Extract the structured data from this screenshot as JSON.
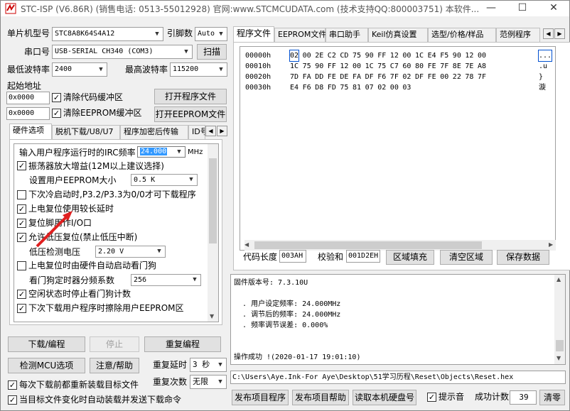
{
  "window": {
    "title": "STC-ISP (V6.86R) (销售电话: 0513-55012928) 官网:www.STCMCUDATA.com  (技术支持QQ:800003751) 本软件...",
    "minimize": "—",
    "maximize": "☐",
    "close": "✕"
  },
  "left": {
    "mcu_label": "单片机型号",
    "mcu_value": "STC8A8K64S4A12",
    "pins_label": "引脚数",
    "pins_value": "Auto",
    "port_label": "串口号",
    "port_value": "USB-SERIAL CH340 (COM3)",
    "scan_button": "扫描",
    "min_baud_label": "最低波特率",
    "min_baud_value": "2400",
    "max_baud_label": "最高波特率",
    "max_baud_value": "115200",
    "start_addr_label": "起始地址",
    "addr1_value": "0x0000",
    "clear_code_label": "清除代码缓冲区",
    "open_program_button": "打开程序文件",
    "addr2_value": "0x0000",
    "clear_eeprom_label": "清除EEPROM缓冲区",
    "open_eeprom_button": "打开EEPROM文件",
    "tabs": [
      "硬件选项",
      "脱机下载/U8/U7",
      "程序加密后传输",
      "ID号"
    ],
    "hw_options": {
      "irc_label": "输入用户程序运行时的IRC频率",
      "irc_value": "24.000",
      "irc_unit": "MHz",
      "opt1": "振荡器放大增益(12M以上建议选择)",
      "eeprom_size_label": "设置用户EEPROM大小",
      "eeprom_size_value": "0.5 K",
      "opt2": "下次冷启动时,P3.2/P3.3为0/0才可下载程序",
      "opt3": "上电复位使用较长延时",
      "opt4": "复位脚用作I/O口",
      "opt5": "允许低压复位(禁止低压中断)",
      "low_volt_label": "低压检测电压",
      "low_volt_value": "2.20 V",
      "opt6": "上电复位时由硬件自动启动看门狗",
      "wdt_label": "看门狗定时器分频系数",
      "wdt_value": "256",
      "opt7": "空闲状态时停止看门狗计数",
      "opt8": "下次下载用户程序时擦除用户EEPROM区"
    },
    "download_button": "下载/编程",
    "stop_button": "停止",
    "reprogram_button": "重复编程",
    "detect_button": "检测MCU选项",
    "notice_button": "注意/帮助",
    "repeat_delay_label": "重复延时",
    "repeat_delay_value": "3 秒",
    "repeat_count_label": "重复次数",
    "repeat_count_value": "无限",
    "reload_before_label": "每次下载前都重新装载目标文件",
    "auto_send_label": "当目标文件变化时自动装载并发送下载命令"
  },
  "right": {
    "tabs": [
      "程序文件",
      "EEPROM文件",
      "串口助手",
      "Keil仿真设置",
      "选型/价格/样品",
      "范例程序"
    ],
    "hex_rows": [
      {
        "addr": "00000h",
        "bytes": [
          "02",
          "00",
          "2E",
          "C2",
          "CD",
          "75",
          "90",
          "FF",
          "12",
          "00",
          "1C",
          "E4",
          "F5",
          "90",
          "12",
          "00"
        ],
        "ascii": "..."
      },
      {
        "addr": "00010h",
        "bytes": [
          "1C",
          "75",
          "90",
          "FF",
          "12",
          "00",
          "1C",
          "75",
          "C7",
          "60",
          "80",
          "FE",
          "7F",
          "8E",
          "7E",
          "A8"
        ],
        "ascii": ".u"
      },
      {
        "addr": "00020h",
        "bytes": [
          "7D",
          "FA",
          "DD",
          "FE",
          "DE",
          "FA",
          "DF",
          "F6",
          "7F",
          "02",
          "DF",
          "FE",
          "00",
          "22",
          "78",
          "7F"
        ],
        "ascii": "}"
      },
      {
        "addr": "00030h",
        "bytes": [
          "E4",
          "F6",
          "D8",
          "FD",
          "75",
          "81",
          "07",
          "02",
          "00",
          "03"
        ],
        "ascii": "漩"
      }
    ],
    "code_len_label": "代码长度",
    "code_len_value": "003AH",
    "checksum_label": "校验和",
    "checksum_value": "001D2EH",
    "fill_button": "区域填充",
    "clear_button": "清空区域",
    "save_button": "保存数据",
    "log_lines": [
      "固件版本号: 7.3.10U",
      "",
      "  . 用户设定频率: 24.000MHz",
      "  . 调节后的频率: 24.000MHz",
      "  . 频率调节误差: 0.000%",
      "",
      "",
      "操作成功 !(2020-01-17 19:01:10)"
    ],
    "path_value": "C:\\Users\\Aye.Ink-For Aye\\Desktop\\51学习历程\\Reset\\Objects\\Reset.hex",
    "publish_program_button": "发布项目程序",
    "publish_help_button": "发布项目帮助",
    "read_disk_button": "读取本机硬盘号",
    "beep_label": "提示音",
    "success_count_label": "成功计数",
    "success_count_value": "39",
    "clear_count_button": "清零"
  },
  "colors": {
    "accent": "#0078d7",
    "highlight": "#3399ff",
    "arrow": "#e02020"
  }
}
